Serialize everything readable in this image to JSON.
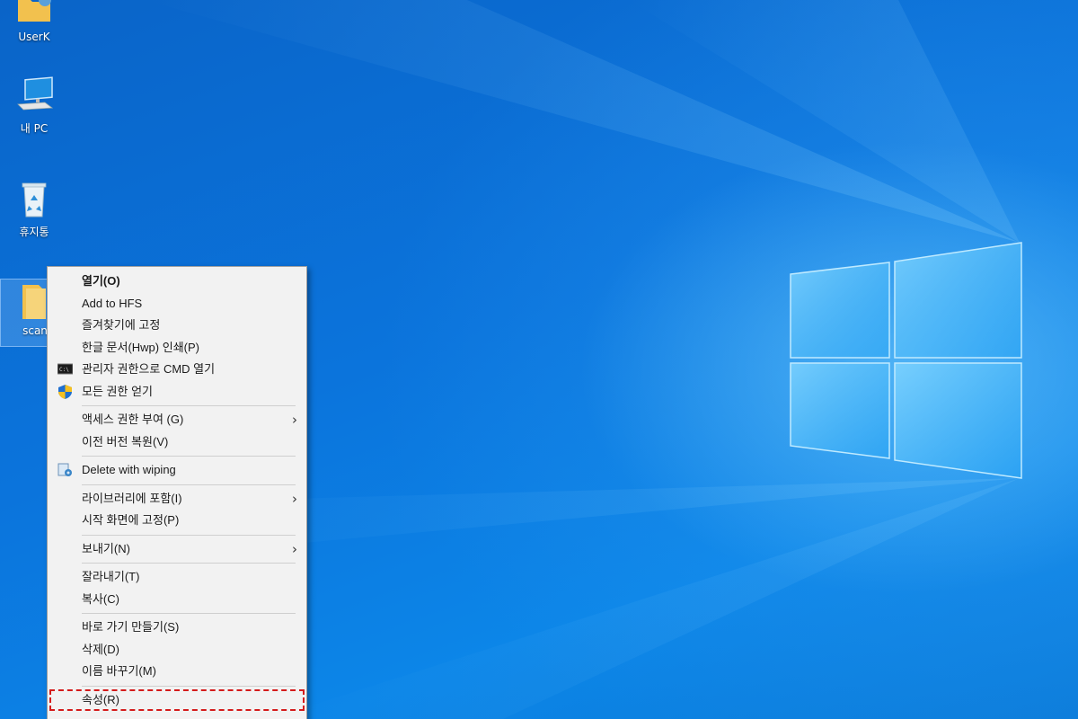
{
  "desktop": {
    "icons": [
      {
        "label": "UserK"
      },
      {
        "label": "내 PC"
      },
      {
        "label": "휴지통"
      },
      {
        "label": "scan"
      }
    ]
  },
  "context_menu": {
    "group1": [
      {
        "label": "열기(O)"
      },
      {
        "label": "Add to HFS"
      },
      {
        "label": "즐겨찾기에 고정"
      },
      {
        "label": "한글 문서(Hwp) 인쇄(P)"
      },
      {
        "label": "관리자 권한으로 CMD 열기"
      },
      {
        "label": "모든 권한 얻기"
      }
    ],
    "group2": [
      {
        "label": "액세스 권한 부여 (G)"
      },
      {
        "label": "이전 버전 복원(V)"
      }
    ],
    "group3": [
      {
        "label": "Delete with wiping"
      }
    ],
    "group4": [
      {
        "label": "라이브러리에 포함(I)"
      },
      {
        "label": "시작 화면에 고정(P)"
      }
    ],
    "group5": [
      {
        "label": "보내기(N)"
      }
    ],
    "group6": [
      {
        "label": "잘라내기(T)"
      },
      {
        "label": "복사(C)"
      }
    ],
    "group7": [
      {
        "label": "바로 가기 만들기(S)"
      },
      {
        "label": "삭제(D)"
      },
      {
        "label": "이름 바꾸기(M)"
      }
    ],
    "group8": [
      {
        "label": "속성(R)"
      }
    ],
    "submenu_arrow": "›",
    "highlight_color": "#d41b1b"
  }
}
